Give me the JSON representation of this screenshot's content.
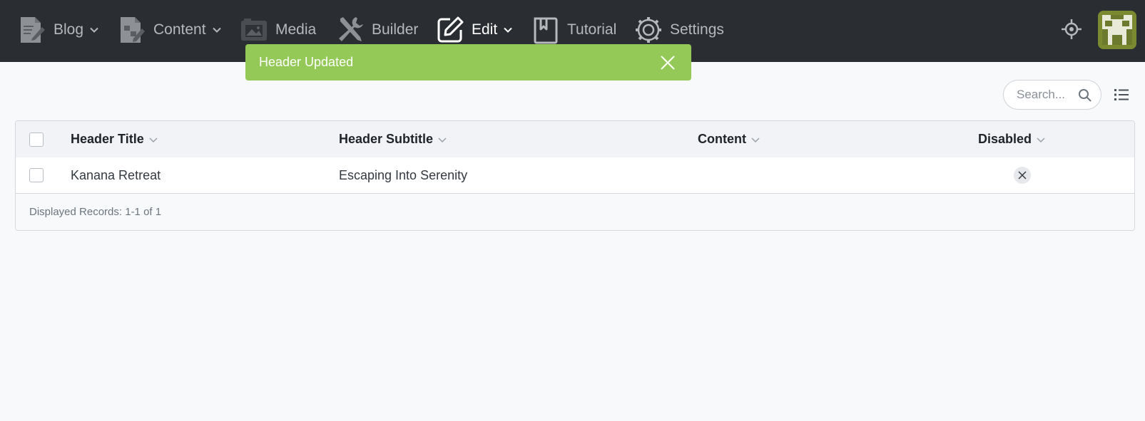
{
  "nav": {
    "items": [
      {
        "label": "Blog",
        "icon": "blog-post-icon",
        "dropdown": true
      },
      {
        "label": "Content",
        "icon": "content-icon",
        "dropdown": true
      },
      {
        "label": "Media",
        "icon": "media-icon",
        "dropdown": false
      },
      {
        "label": "Builder",
        "icon": "tools-icon",
        "dropdown": false
      },
      {
        "label": "Edit",
        "icon": "edit-icon",
        "dropdown": true,
        "active": true
      },
      {
        "label": "Tutorial",
        "icon": "bookmark-book-icon",
        "dropdown": false
      },
      {
        "label": "Settings",
        "icon": "gear-icon",
        "dropdown": false
      }
    ]
  },
  "toast": {
    "message": "Header Updated",
    "color": "#94c957"
  },
  "search": {
    "placeholder": "Search..."
  },
  "table": {
    "columns": [
      "Header Title",
      "Header Subtitle",
      "Content",
      "Disabled"
    ],
    "rows": [
      {
        "header_title": "Kanana Retreat",
        "header_subtitle": "Escaping Into Serenity",
        "content": "",
        "disabled": "no"
      }
    ],
    "footer": "Displayed Records: 1-1 of 1"
  },
  "colors": {
    "topbar": "#2a2d31",
    "accent_success": "#94c957"
  }
}
